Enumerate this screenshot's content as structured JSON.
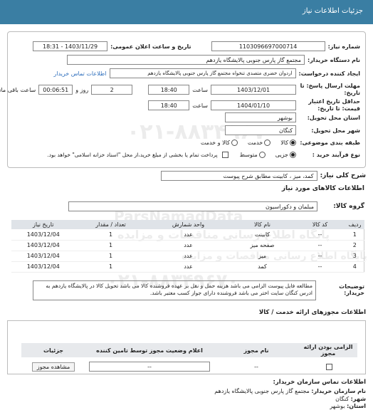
{
  "title": "جزئیات اطلاعات نیاز",
  "fields": {
    "need_number_label": "شماره نیاز:",
    "need_number": "1103096697000714",
    "announce_label": "تاریخ و ساعت اعلان عمومی:",
    "announce_value": "1403/11/29 - 18:31",
    "buyer_label": "نام دستگاه خریدار:",
    "buyer_value": "مجتمع گاز پارس جنوبی  پالایشگاه یازدهم",
    "requester_label": "ایجاد کننده درخواست:",
    "requester_value": "اردوان خضری متصدی تنخواه مجتمع گاز پارس جنوبی  پالایشگاه یازدهم",
    "buyer_contact_link": "اطلاعات تماس خریدار",
    "deadline_label": "مهلت ارسال پاسخ: تا تاریخ:",
    "deadline_date": "1403/12/01",
    "hour_label": "ساعت",
    "deadline_hour": "18:40",
    "days_value": "2",
    "days_label": "روز و",
    "remaining_value": "00:06:51",
    "remaining_label": "ساعت باقی مانده",
    "validity_label": "حداقل تاریخ اعتبار قیمت: تا تاریخ:",
    "validity_date": "1404/01/10",
    "validity_hour": "18:40",
    "province_label": "استان محل تحویل:",
    "province_value": "بوشهر",
    "city_label": "شهر محل تحویل:",
    "city_value": "کنگان",
    "category_label": "طبقه بندی موضوعی:",
    "category_options": [
      "کالا",
      "خدمت",
      "کالا و خدمت"
    ],
    "process_label": "نوع فرآیند خرید :",
    "process_options": [
      "جزیی",
      "متوسط"
    ],
    "payment_note": "پرداخت تمام یا بخشی از مبلغ خرید،از محل \"اسناد خزانه اسلامی\" خواهد بود."
  },
  "summary": {
    "label": "شرح کلی نیاز:",
    "value": "کمد، میز ، کابینت مطابق شرح پیوست"
  },
  "goods": {
    "section_title": "اطلاعات کالاهای مورد نیاز",
    "group_label": "گروه کالا:",
    "group_value": "مبلمان و دکوراسیون",
    "headers": [
      "ردیف",
      "کد کالا",
      "نام کالا",
      "واحد شمارش",
      "تعداد / مقدار",
      "تاریخ نیاز"
    ],
    "rows": [
      [
        "1",
        "--",
        "کابینت",
        "عدد",
        "1",
        "1403/12/04"
      ],
      [
        "2",
        "--",
        "صفحه میز",
        "عدد",
        "1",
        "1403/12/04"
      ],
      [
        "3",
        "--",
        "میز",
        "عدد",
        "1",
        "1403/12/04"
      ],
      [
        "4",
        "--",
        "کمد",
        "عدد",
        "1",
        "1403/12/04"
      ]
    ],
    "buyer_notes_label": "توضیحات خریدار:",
    "buyer_notes": "مطالعه فایل پیوست الزامی می باشد هزینه حمل و نقل بر عهده فروشنده کالا می باشد تحویل کالا در پالایشگاه یازدهم به ادرس کنگان سایت اختر می باشد فروشنده دارای جواز کسب معتبر باشد."
  },
  "licenses": {
    "section_title": "اطلاعات مجوزهای ارائه خدمت / کالا",
    "headers": [
      "الزامی بودن ارائه مجوز",
      "نام مجوز",
      "اعلام وضعیت مجوز توسط تامین کننده",
      "جزئیات"
    ],
    "row": {
      "license_name": "--",
      "status": "--",
      "view_button": "مشاهده مجوز"
    }
  },
  "contact": {
    "section_title": "اطلاعات تماس سازمان خریدار:",
    "org_label": "نام سازمان خریدار:",
    "org_value": "مجتمع گاز پارس جنوبی  پالایشگاه یازدهم",
    "city_label": "شهر:",
    "city_value": "کنگان",
    "province_label": "استان:",
    "province_value": "بوشهر"
  },
  "watermark": {
    "line1": "۰۲۱-۸۸۳۴۹۶۷۰",
    "line2": "ParsNamadData",
    "line3": "پایگاه اطلاع رسانی مناقصات و مزایده",
    "line4": "۰۲۱-۸۸۳۴۹۶۷۰",
    "line5": "پایگاه اطلاع رسانی مناقصات و مزایده"
  }
}
